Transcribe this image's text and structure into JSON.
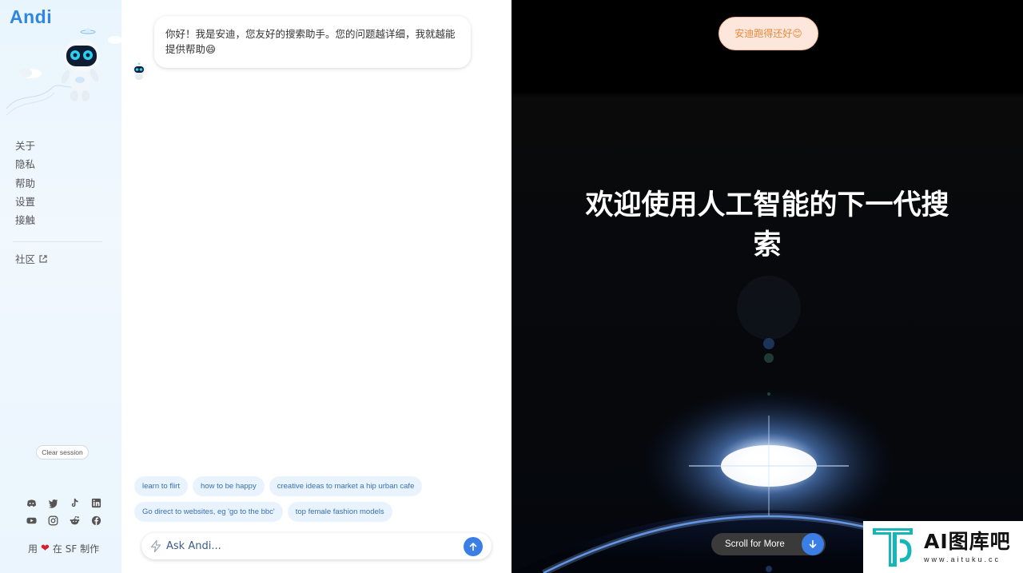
{
  "brand": {
    "name": "Andi"
  },
  "sidebar": {
    "nav": [
      {
        "label": "关于"
      },
      {
        "label": "隐私"
      },
      {
        "label": "帮助"
      },
      {
        "label": "设置"
      },
      {
        "label": "接触"
      }
    ],
    "community_label": "社区",
    "clear_session": "Clear session",
    "socials": [
      "discord-icon",
      "twitter-icon",
      "tiktok-icon",
      "linkedin-icon",
      "youtube-icon",
      "instagram-icon",
      "reddit-icon",
      "facebook-icon"
    ],
    "made_prefix": "用",
    "made_suffix": "在 SF 制作"
  },
  "chat": {
    "greeting": "你好！我是安迪，您友好的搜索助手。您的问题越详细，我就越能提供帮助😄",
    "suggestions_row1": [
      "learn to flirt",
      "how to be happy",
      "creative ideas to market a hip urban cafe"
    ],
    "suggestions_row2": [
      "Go direct to websites, eg 'go to the bbc'",
      "top female fashion models"
    ],
    "input_placeholder": "Ask Andi..."
  },
  "panel": {
    "status_pill": "安迪跑得还好😊",
    "hero_line1": "欢迎使用人工智能的下一代搜",
    "hero_line2": "索",
    "scroll_label": "Scroll for More"
  },
  "watermark": {
    "title": "AI图库吧",
    "url": "www.aituku.cc"
  },
  "colors": {
    "accent": "#3b7ee6",
    "brand": "#2f86e4",
    "chip_bg": "#e9f3fd",
    "pill_bg": "#fde7dc"
  }
}
